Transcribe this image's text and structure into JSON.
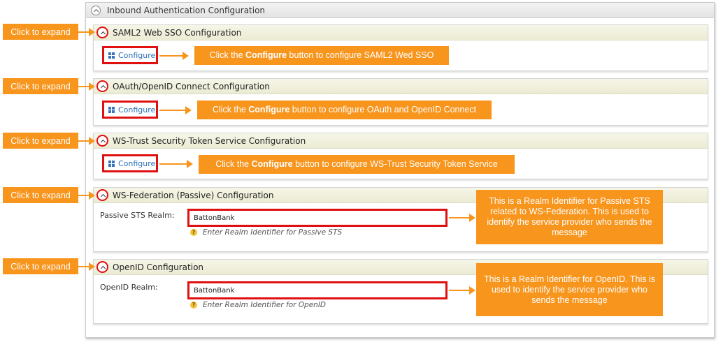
{
  "outer": {
    "title": "Inbound Authentication Configuration"
  },
  "expand_label": "Click to expand",
  "sections": {
    "saml": {
      "title": "SAML2 Web SSO Configuration",
      "button": "Configure",
      "callout_pre": "Click the ",
      "callout_bold": "Configure",
      "callout_post": " button to configure SAML2 Wed SSO"
    },
    "oauth": {
      "title": "OAuth/OpenID Connect Configuration",
      "button": "Configure",
      "callout_pre": "Click the ",
      "callout_bold": "Configure",
      "callout_post": " button to configure OAuth and OpenID Connect"
    },
    "wstrust": {
      "title": "WS-Trust Security Token Service Configuration",
      "button": "Configure",
      "callout_pre": "Click the ",
      "callout_bold": "Configure",
      "callout_post": " button to configure WS-Trust Security Token Service"
    },
    "wsfed": {
      "title": "WS-Federation (Passive) Configuration",
      "field_label": "Passive STS Realm:",
      "field_value": "BattonBank",
      "hint": "Enter Realm Identifier for Passive STS",
      "callout": "This is a Realm Identifier for Passive STS related to WS-Federation. This is used to identify the service provider who sends the message"
    },
    "openid": {
      "title": "OpenID Configuration",
      "field_label": "OpenID Realm:",
      "field_value": "BattonBank",
      "hint": "Enter Realm Identifier for OpenID",
      "callout": "This is a Realm Identifier for OpenID. This is used to identify the service provider who sends the message"
    }
  },
  "colors": {
    "callout_orange": "#f7951d",
    "highlight_red": "#e01010",
    "link_blue": "#2a6fb5"
  }
}
